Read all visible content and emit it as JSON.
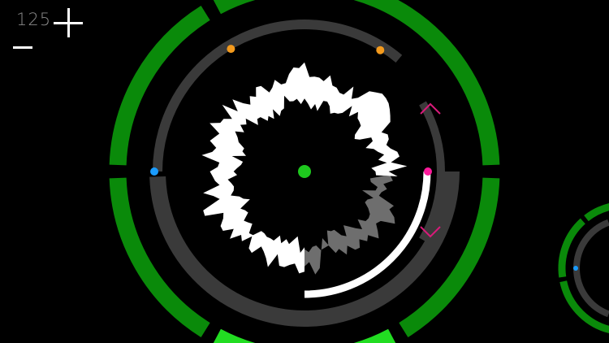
{
  "hud": {
    "tempo": "125",
    "increase_icon": "plus-icon",
    "decrease_icon": "minus-icon"
  },
  "colors": {
    "background": "#000000",
    "ring_green": "#0a8a0a",
    "ring_green_active": "#22dd22",
    "track_gray": "#3a3a3a",
    "playhead_white": "#ffffff",
    "waveform_white": "#ffffff",
    "waveform_played": "#6e6e6e",
    "center_dot": "#1ec81e",
    "marker_orange": "#f39a1d",
    "marker_blue": "#1a9cff",
    "marker_magenta": "#ff1a9c",
    "chevron_magenta": "#d91a7a"
  },
  "icons": {
    "upper_chevron": "chevron-up-icon",
    "lower_chevron": "chevron-down-icon"
  }
}
